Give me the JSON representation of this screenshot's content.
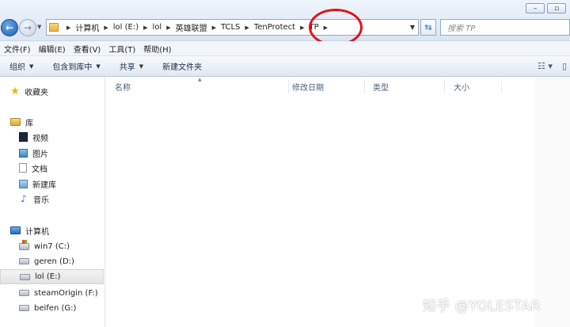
{
  "window": {
    "controls": [
      "–",
      "▫"
    ]
  },
  "address": {
    "crumbs": [
      "计算机",
      "lol (E:)",
      "lol",
      "英雄联盟",
      "TCLS",
      "TenProtect",
      "TP"
    ],
    "search_placeholder": "搜索 TP"
  },
  "menu": [
    "文件(F)",
    "编辑(E)",
    "查看(V)",
    "工具(T)",
    "帮助(H)"
  ],
  "commands": [
    {
      "label": "组织",
      "dropdown": true
    },
    {
      "label": "包含到库中",
      "dropdown": true
    },
    {
      "label": "共享",
      "dropdown": true
    },
    {
      "label": "新建文件夹",
      "dropdown": false
    }
  ],
  "nav": {
    "favorites": "收藏夹",
    "libraries": "库",
    "library_items": [
      "视频",
      "图片",
      "文档",
      "新建库",
      "音乐"
    ],
    "computer": "计算机",
    "drives": [
      "win7 (C:)",
      "geren (D:)",
      "lol (E:)",
      "steamOrigin (F:)",
      "beifen (G:)"
    ],
    "selected_drive": "lol (E:)"
  },
  "columns": [
    "名称",
    "修改日期",
    "类型",
    "大小"
  ],
  "watermark": "知乎 @YOLESTAR",
  "annotation_color": "#e0121c"
}
